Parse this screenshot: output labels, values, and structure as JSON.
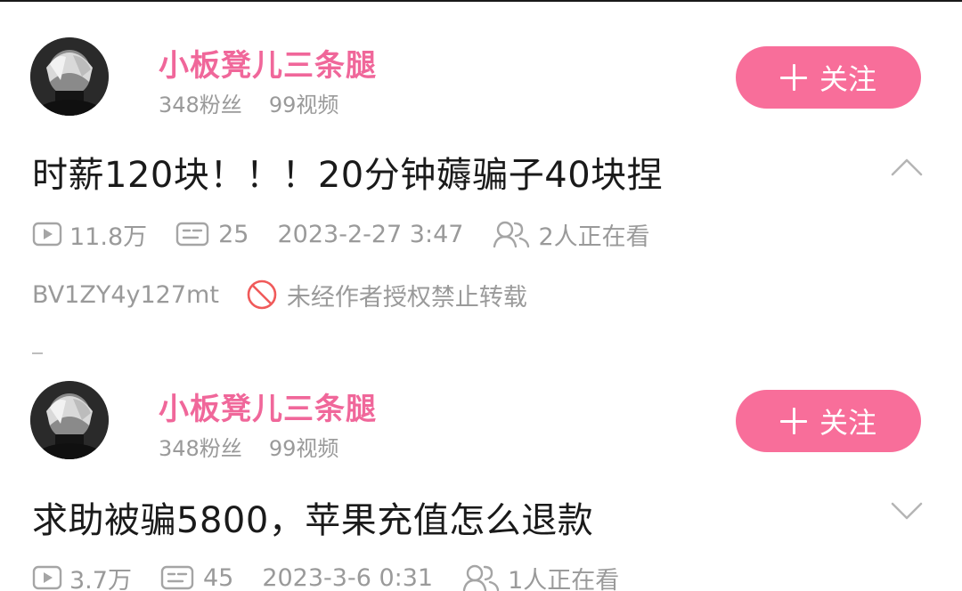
{
  "posts": [
    {
      "author": {
        "name": "小板凳儿三条腿",
        "fans": "348粉丝",
        "videos": "99视频"
      },
      "follow_label": "关注",
      "title": "时薪120块！！！20分钟薅骗子40块捏",
      "expanded": true,
      "views": "11.8万",
      "comments": "25",
      "date": "2023-2-27 3:47",
      "watching": "2人正在看",
      "bvid": "BV1ZY4y127mt",
      "copyright": "未经作者授权禁止转载"
    },
    {
      "author": {
        "name": "小板凳儿三条腿",
        "fans": "348粉丝",
        "videos": "99视频"
      },
      "follow_label": "关注",
      "title": "求助被骗5800，苹果充值怎么退款",
      "expanded": false,
      "views": "3.7万",
      "comments": "45",
      "date": "2023-3-6 0:31",
      "watching": "1人正在看"
    }
  ],
  "colors": {
    "accent": "#f86e9a",
    "author_name": "#f0679a",
    "meta_text": "#9a9a9a",
    "title_text": "#1a1a1a",
    "forbid_icon": "#f05a5a"
  },
  "icons": {
    "views": "play-count-icon",
    "comments": "danmaku-icon",
    "watching": "people-icon",
    "copyright": "forbidden-icon",
    "expand": "chevron-icon"
  }
}
